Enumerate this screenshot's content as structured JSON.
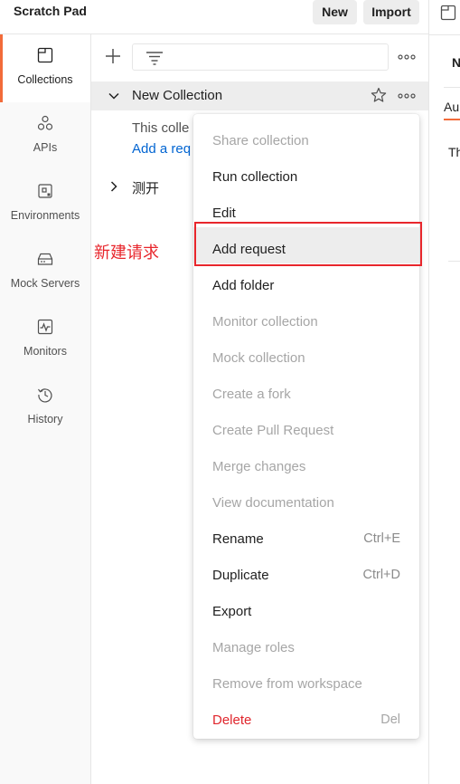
{
  "topbar": {
    "workspace_title": "Scratch Pad",
    "new_label": "New",
    "import_label": "Import"
  },
  "sidebar": {
    "items": [
      {
        "label": "Collections",
        "icon": "collections-icon",
        "active": true
      },
      {
        "label": "APIs",
        "icon": "apis-icon"
      },
      {
        "label": "Environments",
        "icon": "environments-icon"
      },
      {
        "label": "Mock Servers",
        "icon": "mock-servers-icon"
      },
      {
        "label": "Monitors",
        "icon": "monitors-icon"
      },
      {
        "label": "History",
        "icon": "history-icon"
      }
    ]
  },
  "collections": {
    "items": [
      {
        "name": "New Collection",
        "expanded": true,
        "empty_text": "This colle",
        "add_link": "Add a req"
      },
      {
        "name": "测开",
        "expanded": false
      }
    ]
  },
  "right_panel": {
    "header_initial": "N",
    "tab_partial": "Au",
    "body_partial": "Th"
  },
  "annotation": {
    "text": "新建请求",
    "color": "#e8262c"
  },
  "context_menu": {
    "items": [
      {
        "label": "Share collection",
        "disabled": true
      },
      {
        "label": "Run collection"
      },
      {
        "label": "Edit"
      },
      {
        "label": "Add request",
        "highlighted": true
      },
      {
        "label": "Add folder"
      },
      {
        "label": "Monitor collection",
        "disabled": true
      },
      {
        "label": "Mock collection",
        "disabled": true
      },
      {
        "label": "Create a fork",
        "disabled": true
      },
      {
        "label": "Create Pull Request",
        "disabled": true
      },
      {
        "label": "Merge changes",
        "disabled": true
      },
      {
        "label": "View documentation",
        "disabled": true
      },
      {
        "label": "Rename",
        "shortcut": "Ctrl+E"
      },
      {
        "label": "Duplicate",
        "shortcut": "Ctrl+D"
      },
      {
        "label": "Export"
      },
      {
        "label": "Manage roles",
        "disabled": true
      },
      {
        "label": "Remove from workspace",
        "disabled": true
      },
      {
        "label": "Delete",
        "shortcut": "Del",
        "danger": true
      }
    ]
  },
  "colors": {
    "accent": "#f26b3a",
    "link": "#0265d2",
    "danger": "#e0262d"
  }
}
